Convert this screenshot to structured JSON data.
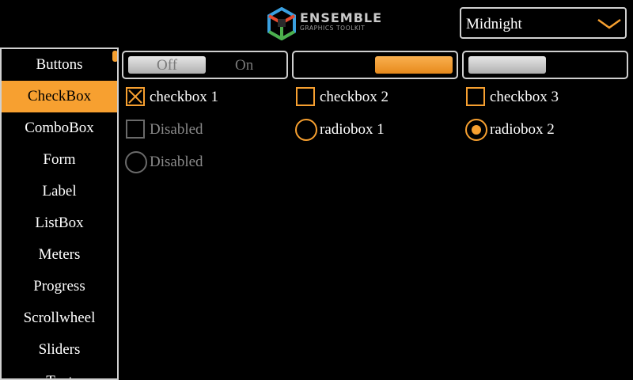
{
  "header": {
    "logo_title": "ENSEMBLE",
    "logo_subtitle": "GRAPHICS TOOLKIT",
    "theme_select": {
      "value": "Midnight"
    }
  },
  "sidebar": {
    "items": [
      {
        "label": "Buttons"
      },
      {
        "label": "CheckBox"
      },
      {
        "label": "ComboBox"
      },
      {
        "label": "Form"
      },
      {
        "label": "Label"
      },
      {
        "label": "ListBox"
      },
      {
        "label": "Meters"
      },
      {
        "label": "Progress"
      },
      {
        "label": "Scrollwheel"
      },
      {
        "label": "Sliders"
      },
      {
        "label": "Text"
      }
    ],
    "active": "CheckBox"
  },
  "toggles": {
    "off_label": "Off",
    "on_label": "On"
  },
  "checkboxes": {
    "cb1": {
      "label": "checkbox 1",
      "checked": true
    },
    "cb2": {
      "label": "checkbox 2",
      "checked": false
    },
    "cb3": {
      "label": "checkbox 3",
      "checked": false
    },
    "cb_disabled": {
      "label": "Disabled",
      "checked": false
    }
  },
  "radios": {
    "rb1": {
      "label": "radiobox 1",
      "selected": false
    },
    "rb2": {
      "label": "radiobox 2",
      "selected": true
    },
    "rb_disabled": {
      "label": "Disabled",
      "selected": false
    }
  },
  "colors": {
    "accent": "#f7a030",
    "background": "#000000",
    "disabled": "#6a6a6a"
  }
}
